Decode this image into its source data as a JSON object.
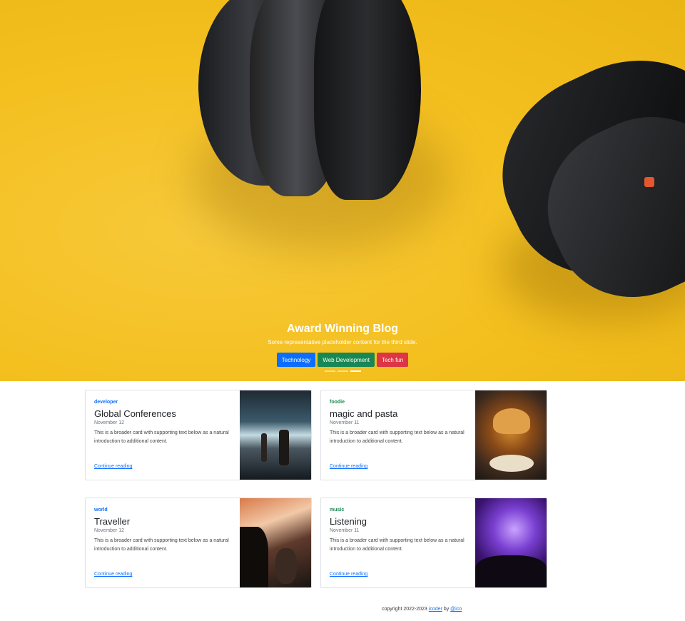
{
  "hero": {
    "title": "Award Winning Blog",
    "subtitle": "Some representative placeholder content for the third slide.",
    "buttons": [
      "Technology",
      "Web Development",
      "Tech fun"
    ],
    "slides": 3,
    "active_slide": 3
  },
  "cards": [
    {
      "category": "developer",
      "title": "Global Conferences",
      "date": "November 12",
      "text": "This is a broader card with supporting text below as a natural introduction to additional content.",
      "link": "Continue reading"
    },
    {
      "category": "foodie",
      "title": "magic and pasta",
      "date": "November 11",
      "text": "This is a broader card with supporting text below as a natural introduction to additional content.",
      "link": "Continue reading"
    },
    {
      "category": "world",
      "title": "Traveller",
      "date": "November 12",
      "text": "This is a broader card with supporting text below as a natural introduction to additional content.",
      "link": "Continue reading"
    },
    {
      "category": "music",
      "title": "Listening",
      "date": "November 11",
      "text": "This is a broader card with supporting text below as a natural introduction to additional content.",
      "link": "Continue reading"
    }
  ],
  "footer": {
    "prefix": "copyright 2022-2023",
    "site": "icoder",
    "by": "by",
    "author": "@ico"
  },
  "colors": {
    "primary": "#0d6efd",
    "success": "#198754",
    "danger": "#dc3545",
    "hero_bg": "#f4c020"
  }
}
